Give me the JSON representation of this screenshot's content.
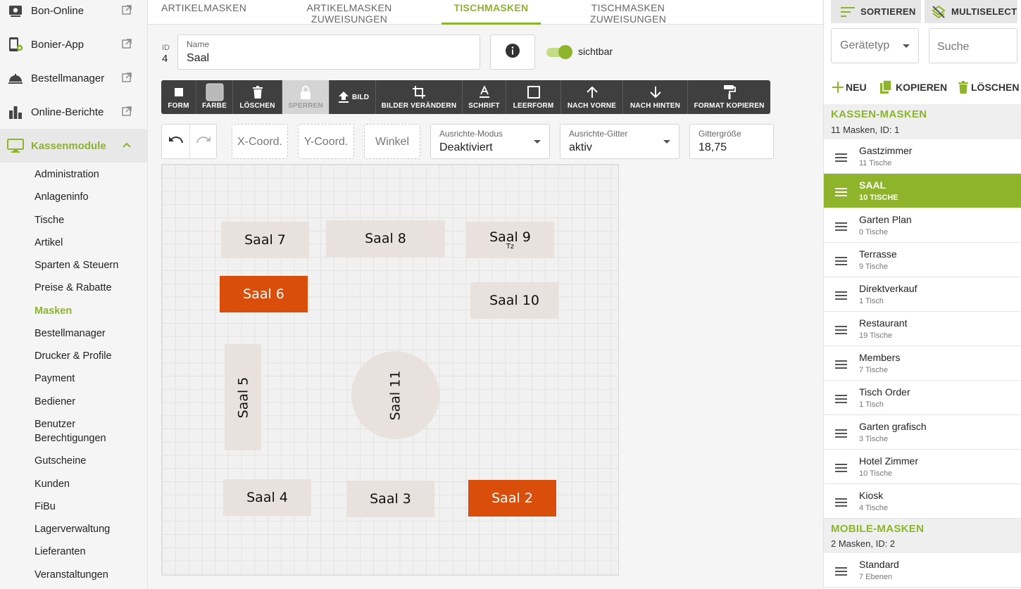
{
  "sidebar": {
    "top_items": [
      {
        "label": "Bon-Online",
        "icon": "cash-register-icon",
        "external": true
      },
      {
        "label": "Bonier-App",
        "icon": "tablet-settings-icon",
        "external": true
      },
      {
        "label": "Bestellmanager",
        "icon": "cloche-icon",
        "external": true
      },
      {
        "label": "Online-Berichte",
        "icon": "bar-chart-icon",
        "external": true
      },
      {
        "label": "Kassenmodule",
        "icon": "monitor-icon",
        "expanded": true
      }
    ],
    "sub_items": [
      "Administration",
      "Anlageninfo",
      "Tische",
      "Artikel",
      "Sparten & Steuern",
      "Preise & Rabatte",
      "Masken",
      "Bestellmanager",
      "Drucker & Profile",
      "Payment",
      "Bediener",
      "Benutzer",
      "Berechtigungen",
      "Gutscheine",
      "Kunden",
      "FiBu",
      "Lagerverwaltung",
      "Lieferanten",
      "Veranstaltungen"
    ],
    "active_sub": "Masken"
  },
  "tabs": [
    "ARTIKELMASKEN",
    "ARTIKELMASKEN ZUWEISUNGEN",
    "TISCHMASKEN",
    "TISCHMASKEN ZUWEISUNGEN"
  ],
  "active_tab": "TISCHMASKEN",
  "form": {
    "id_label": "ID",
    "id_value": "4",
    "name_label": "Name",
    "name_value": "Saal",
    "visible_label": "sichtbar",
    "visible": true
  },
  "toolbar": {
    "form": "FORM",
    "farbe": "FARBE",
    "loeschen": "LÖSCHEN",
    "sperren": "SPERREN",
    "bild": "BILD",
    "bilder_veraendern": "BILDER VERÄNDERN",
    "schrift": "SCHRIFT",
    "leerform": "LEERFORM",
    "nach_vorne": "NACH VORNE",
    "nach_hinten": "NACH HINTEN",
    "format_kopieren": "FORMAT KOPIEREN"
  },
  "coords": {
    "x_placeholder": "X-Coord.",
    "y_placeholder": "Y-Coord.",
    "winkel_placeholder": "Winkel",
    "align_mode_label": "Ausrichte-Modus",
    "align_mode_value": "Deaktiviert",
    "align_grid_label": "Ausrichte-Gitter",
    "align_grid_value": "aktiv",
    "grid_size_label": "Gittergröße",
    "grid_size_value": "18,75"
  },
  "tables": [
    {
      "label": "Saal 7",
      "sub": "",
      "color": "#e9e1dd"
    },
    {
      "label": "Saal 8",
      "sub": "",
      "color": "#e9e1dd"
    },
    {
      "label": "Saal 9",
      "sub": "Tz",
      "color": "#e9e1dd"
    },
    {
      "label": "Saal 6",
      "sub": "",
      "color": "#d84e0a"
    },
    {
      "label": "Saal 10",
      "sub": "",
      "color": "#e9e1dd"
    },
    {
      "label": "Saal 5",
      "sub": "",
      "color": "#e9e1dd"
    },
    {
      "label": "Saal 11",
      "sub": "",
      "color": "#e9e1dd"
    },
    {
      "label": "Saal 4",
      "sub": "",
      "color": "#e9e1dd"
    },
    {
      "label": "Saal 3",
      "sub": "",
      "color": "#e9e1dd"
    },
    {
      "label": "Saal 2",
      "sub": "",
      "color": "#d84e0a"
    }
  ],
  "right": {
    "sort_label": "SORTIEREN",
    "multiselect_label": "MULTISELECT",
    "device_type_placeholder": "Gerätetyp",
    "search_placeholder": "Suche",
    "new_label": "NEU",
    "copy_label": "KOPIEREN",
    "delete_label": "LÖSCHEN",
    "kassen": {
      "title": "KASSEN-MASKEN",
      "summary": "11 Masken, ID: 1",
      "items": [
        {
          "name": "Gastzimmer",
          "count": "11 Tische"
        },
        {
          "name": "Saal",
          "count": "10 Tische"
        },
        {
          "name": "Garten Plan",
          "count": "0 Tische"
        },
        {
          "name": "Terrasse",
          "count": "9 Tische"
        },
        {
          "name": "Direktverkauf",
          "count": "1 Tisch"
        },
        {
          "name": "Restaurant",
          "count": "19 Tische"
        },
        {
          "name": "Members",
          "count": "7 Tische"
        },
        {
          "name": "Tisch Order",
          "count": "1 Tisch"
        },
        {
          "name": "Garten grafisch",
          "count": "3 Tische"
        },
        {
          "name": "Hotel Zimmer",
          "count": "10 Tische"
        },
        {
          "name": "Kiosk",
          "count": "4 Tische"
        }
      ],
      "active": "Saal"
    },
    "mobile": {
      "title": "MOBILE-MASKEN",
      "summary": "2 Masken, ID: 2",
      "items": [
        {
          "name": "Standard",
          "count": "7 Ebenen"
        }
      ]
    }
  },
  "colors": {
    "accent": "#8db42a",
    "toolbar": "#3f3f3f",
    "table_default": "#e9e1dd",
    "table_highlight": "#d84e0a"
  }
}
